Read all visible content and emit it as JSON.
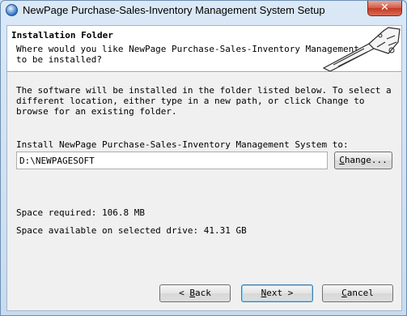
{
  "window": {
    "title": "NewPage Purchase-Sales-Inventory Management System Setup",
    "close_glyph": "✕"
  },
  "header": {
    "title": "Installation Folder",
    "description": "Where would you like NewPage Purchase-Sales-Inventory Management System to be installed?"
  },
  "body": {
    "instructions": "The software will be installed in the folder listed below. To select a different location, either type in a new path, or click Change to browse for an existing folder.",
    "install_label": "Install NewPage Purchase-Sales-Inventory Management System to:",
    "install_path": "D:\\NEWPAGESOFT",
    "space_required": "Space required: 106.8 MB",
    "space_available": "Space available on selected drive: 41.31 GB"
  },
  "buttons": {
    "change": {
      "accel": "C",
      "rest": "hange..."
    },
    "back": {
      "prefix": "< ",
      "accel": "B",
      "rest": "ack"
    },
    "next": {
      "accel": "N",
      "rest": "ext >"
    },
    "cancel": {
      "accel": "C",
      "rest": "ancel"
    }
  },
  "colors": {
    "titlebar": "#cfe1f3",
    "client": "#f0f0f0",
    "close_button": "#c9462f",
    "default_button_border": "#3c7fb1"
  }
}
